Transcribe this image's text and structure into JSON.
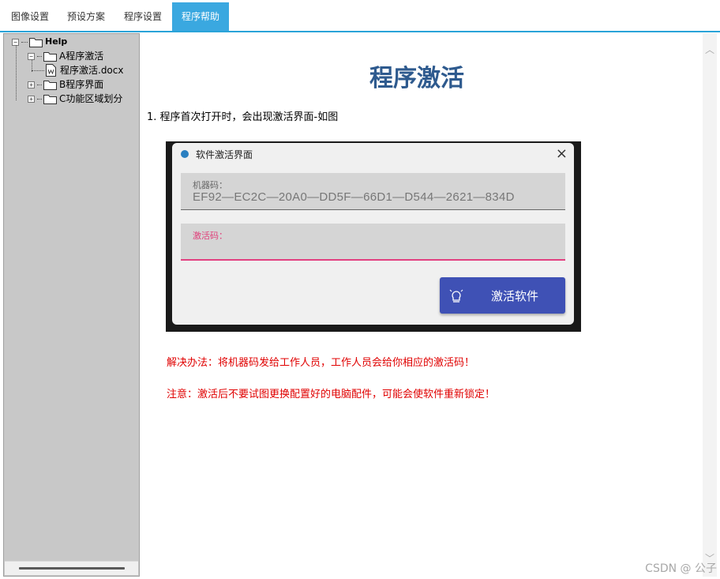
{
  "tabs": [
    {
      "label": "图像设置"
    },
    {
      "label": "预设方案"
    },
    {
      "label": "程序设置"
    },
    {
      "label": "程序帮助",
      "active": true
    }
  ],
  "tree": {
    "root": "Help",
    "items": [
      {
        "label": "A程序激活",
        "expanded": true,
        "children": [
          {
            "label": "程序激活.docx"
          }
        ]
      },
      {
        "label": "B程序界面",
        "expanded": false
      },
      {
        "label": "C功能区域划分",
        "expanded": false
      }
    ]
  },
  "content": {
    "title": "程序激活",
    "step1": "1. 程序首次打开时，会出现激活界面-如图",
    "dialog": {
      "title": "软件激活界面",
      "close_icon": "×",
      "machine_code_label": "机器码：",
      "machine_code_value": "EF92—EC2C—20A0—DD5F—66D1—D544—2621—834D",
      "activation_code_label": "激活码：",
      "activation_code_value": "",
      "activate_button": "激活软件"
    },
    "solution": "解决办法：将机器码发给工作人员，工作人员会给你相应的激活码！",
    "warning": "注意：激活后不要试图更换配置好的电脑配件，可能会使软件重新锁定！"
  },
  "watermark": "CSDN @ 公子",
  "colors": {
    "tab_active": "#3aa8e0",
    "title": "#2e5a8e",
    "notes": "#e00000",
    "button": "#3f51b5",
    "focus_underline": "#e24080"
  }
}
